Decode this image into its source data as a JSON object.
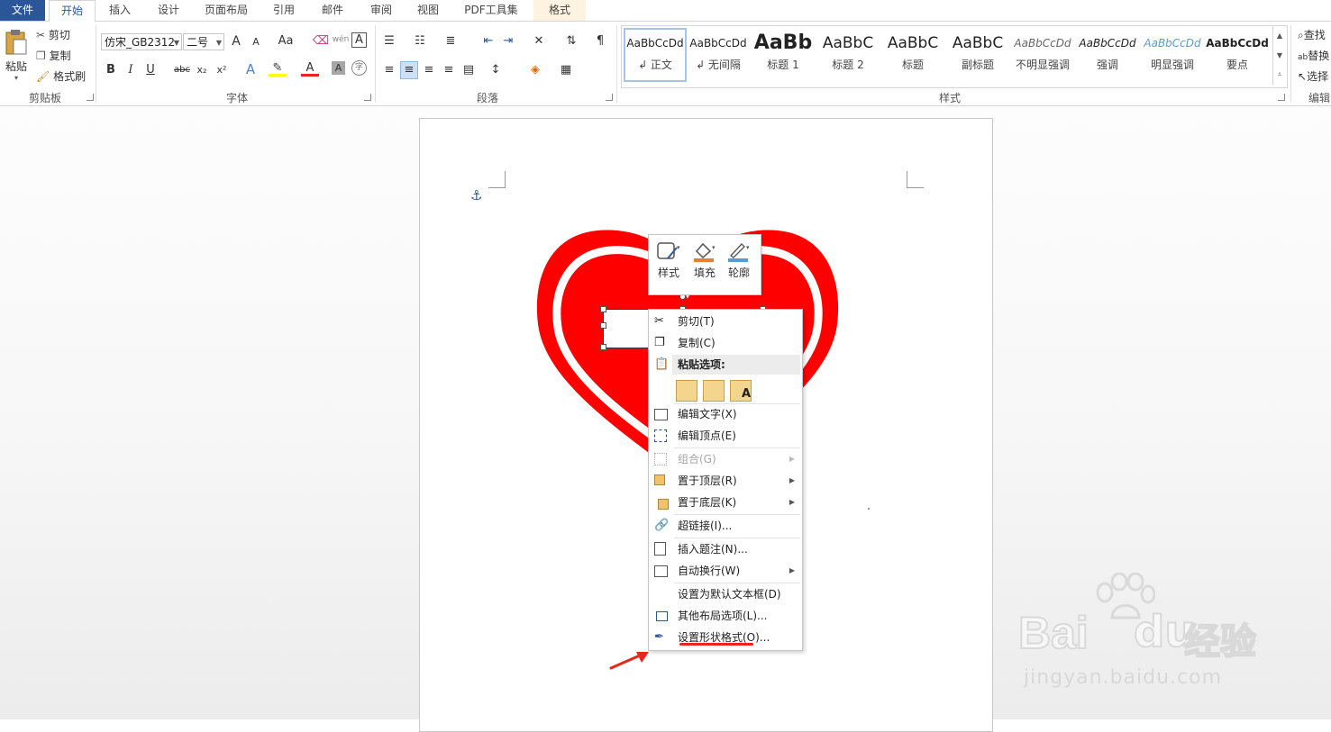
{
  "tabs": [
    "文件",
    "开始",
    "插入",
    "设计",
    "页面布局",
    "引用",
    "邮件",
    "审阅",
    "视图",
    "PDF工具集",
    "格式"
  ],
  "clipboard": {
    "paste": "粘贴",
    "cut": "剪切",
    "copy": "复制",
    "format_painter": "格式刷",
    "group": "剪贴板"
  },
  "font": {
    "name": "仿宋_GB2312",
    "size": "二号",
    "group": "字体",
    "bold": "B",
    "italic": "I",
    "underline": "U",
    "strike": "abc",
    "sub": "x₂",
    "sup": "x²",
    "grow": "A",
    "shrink": "A",
    "case": "Aa",
    "phonetic": "wén",
    "border_char": "A",
    "color_a": "A",
    "shade_a": "A",
    "enclose": "字"
  },
  "paragraph": {
    "group": "段落"
  },
  "styles": {
    "group": "样式",
    "items": [
      {
        "sample": "AaBbCcDd",
        "name": "↲ 正文"
      },
      {
        "sample": "AaBbCcDd",
        "name": "↲ 无间隔"
      },
      {
        "sample": "AaBb",
        "name": "标题 1"
      },
      {
        "sample": "AaBbC",
        "name": "标题 2"
      },
      {
        "sample": "AaBbC",
        "name": "标题"
      },
      {
        "sample": "AaBbC",
        "name": "副标题"
      },
      {
        "sample": "AaBbCcDd",
        "name": "不明显强调"
      },
      {
        "sample": "AaBbCcDd",
        "name": "强调"
      },
      {
        "sample": "AaBbCcDd",
        "name": "明显强调"
      },
      {
        "sample": "AaBbCcDd",
        "name": "要点"
      }
    ]
  },
  "editing": {
    "find": "查找",
    "replace": "替换",
    "select": "选择",
    "group": "编辑"
  },
  "mini_toolbar": {
    "style": "样式",
    "fill": "填充",
    "outline": "轮廓"
  },
  "context_menu": {
    "cut": "剪切(T)",
    "copy": "复制(C)",
    "paste_options": "粘贴选项:",
    "edit_text": "编辑文字(X)",
    "edit_points": "编辑顶点(E)",
    "group": "组合(G)",
    "bring_front": "置于顶层(R)",
    "send_back": "置于底层(K)",
    "hyperlink": "超链接(I)...",
    "insert_caption": "插入题注(N)...",
    "wrap_text": "自动换行(W)",
    "set_default_textbox": "设置为默认文本框(D)",
    "more_layout": "其他布局选项(L)...",
    "format_shape": "设置形状格式(O)..."
  },
  "watermark": {
    "brand": "Bai",
    "brand2": "经验",
    "url": "jingyan.baidu.com"
  },
  "colors": {
    "accent": "#2b579a",
    "heart": "#ff0000",
    "annotation": "#e8251f"
  }
}
